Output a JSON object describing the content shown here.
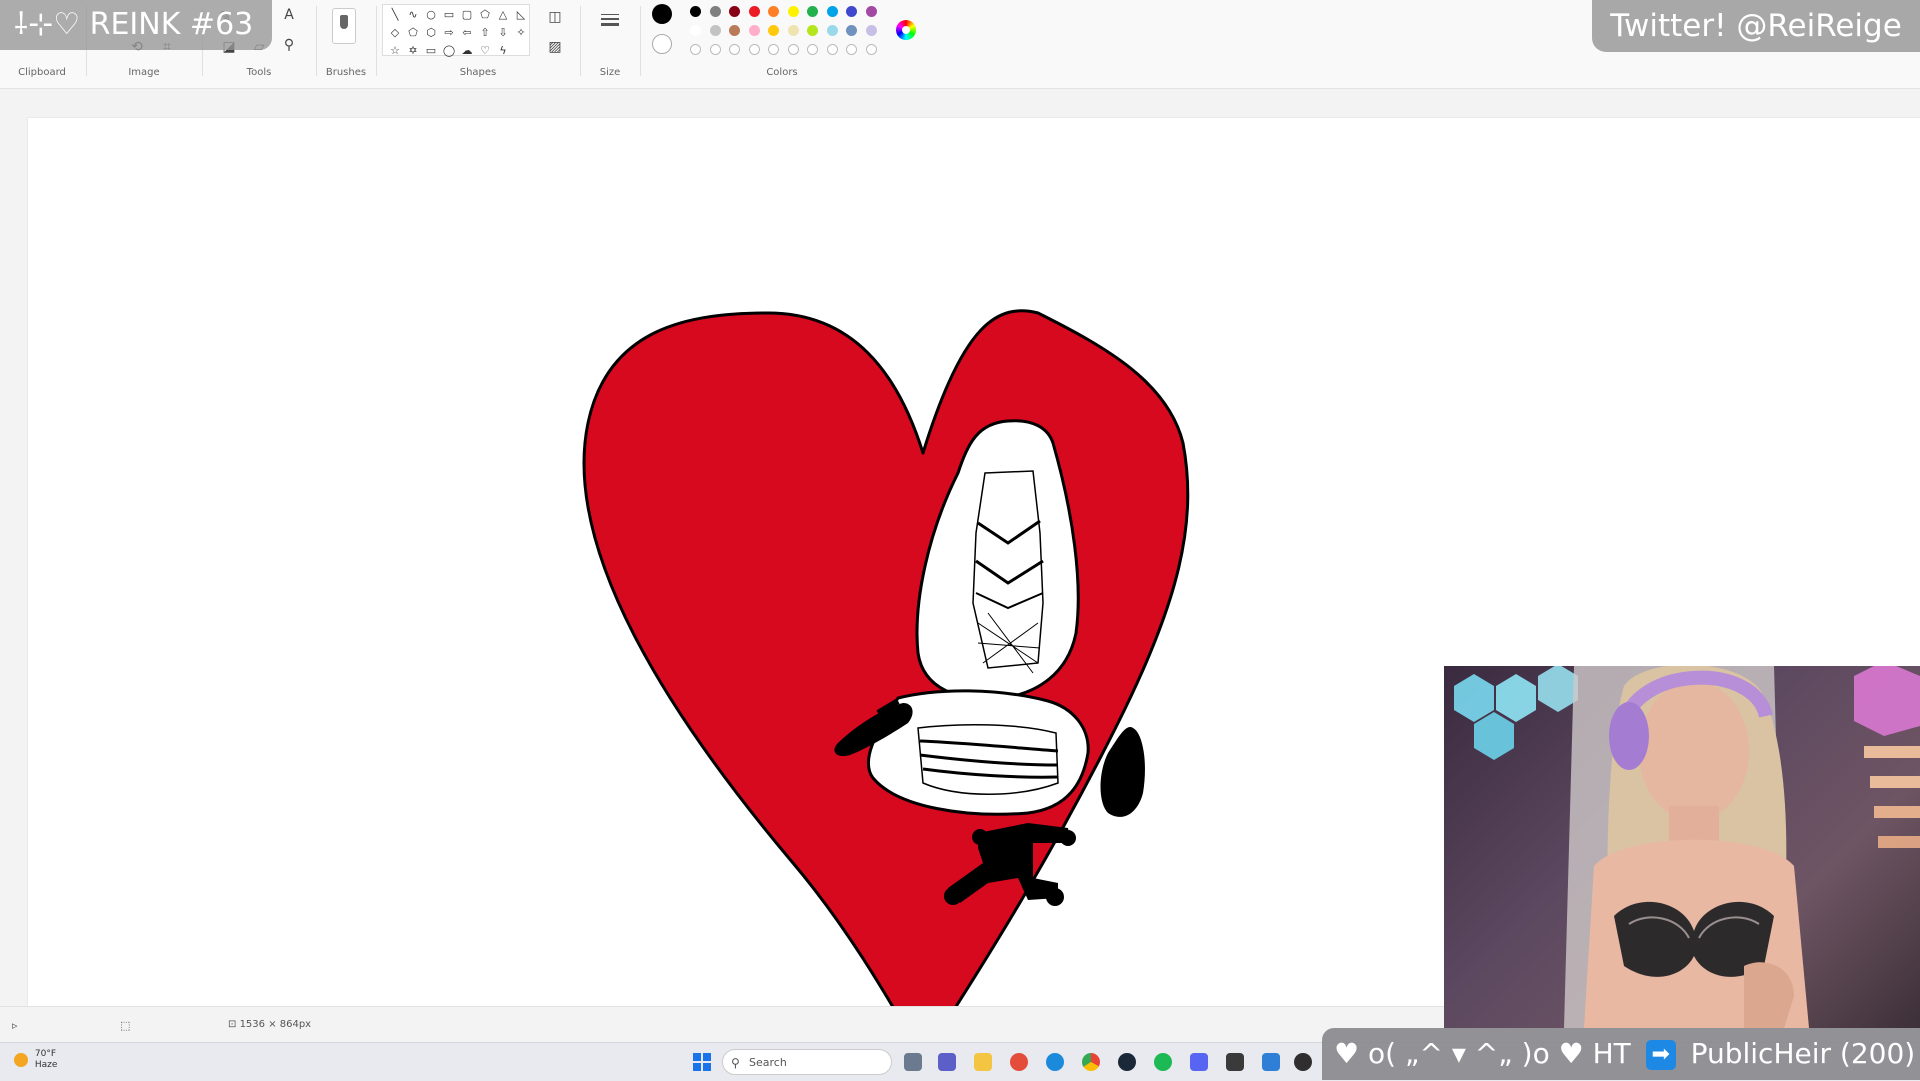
{
  "overlay": {
    "title": "⸸⊹♡ REINK #63",
    "twitter": "Twitter! @ReiReige"
  },
  "ribbon": {
    "groups": {
      "clipboard": "Clipboard",
      "image": "Image",
      "tools": "Tools",
      "brushes": "Brushes",
      "shapes": "Shapes",
      "size": "Size",
      "colors": "Colors"
    },
    "tool_icons": [
      "pencil-icon",
      "fill-icon",
      "text-icon",
      "eraser-icon",
      "color-picker-icon",
      "magnifier-icon"
    ],
    "colors": {
      "selected_primary": "#000000",
      "selected_secondary": "#ffffff",
      "row1": [
        "#000000",
        "#7f7f7f",
        "#880015",
        "#ed1c24",
        "#ff7f27",
        "#fff200",
        "#22b14c",
        "#00a2e8",
        "#3f48cc",
        "#a349a4"
      ],
      "row2": [
        "#ffffff",
        "#c3c3c3",
        "#b97a57",
        "#ffaec9",
        "#ffc90e",
        "#efe4b0",
        "#b5e61d",
        "#99d9ea",
        "#7092be",
        "#c8bfe7"
      ],
      "row3": [
        "empty",
        "empty",
        "empty",
        "empty",
        "empty",
        "empty",
        "empty",
        "empty",
        "empty",
        "empty"
      ]
    }
  },
  "canvas": {
    "heart_color": "#d6091f",
    "outline_color": "#000000",
    "chair_color": "#ffffff"
  },
  "statusbar": {
    "size_text": "1536 × 864px"
  },
  "taskbar": {
    "weather_temp": "70°F",
    "weather_desc": "Haze",
    "search_placeholder": "Search"
  },
  "alert": {
    "prefix": "♥ o( „^ ▾ ^„ )o ♥ HT",
    "arrow": "➡",
    "text": "PublicHeir (200)"
  }
}
